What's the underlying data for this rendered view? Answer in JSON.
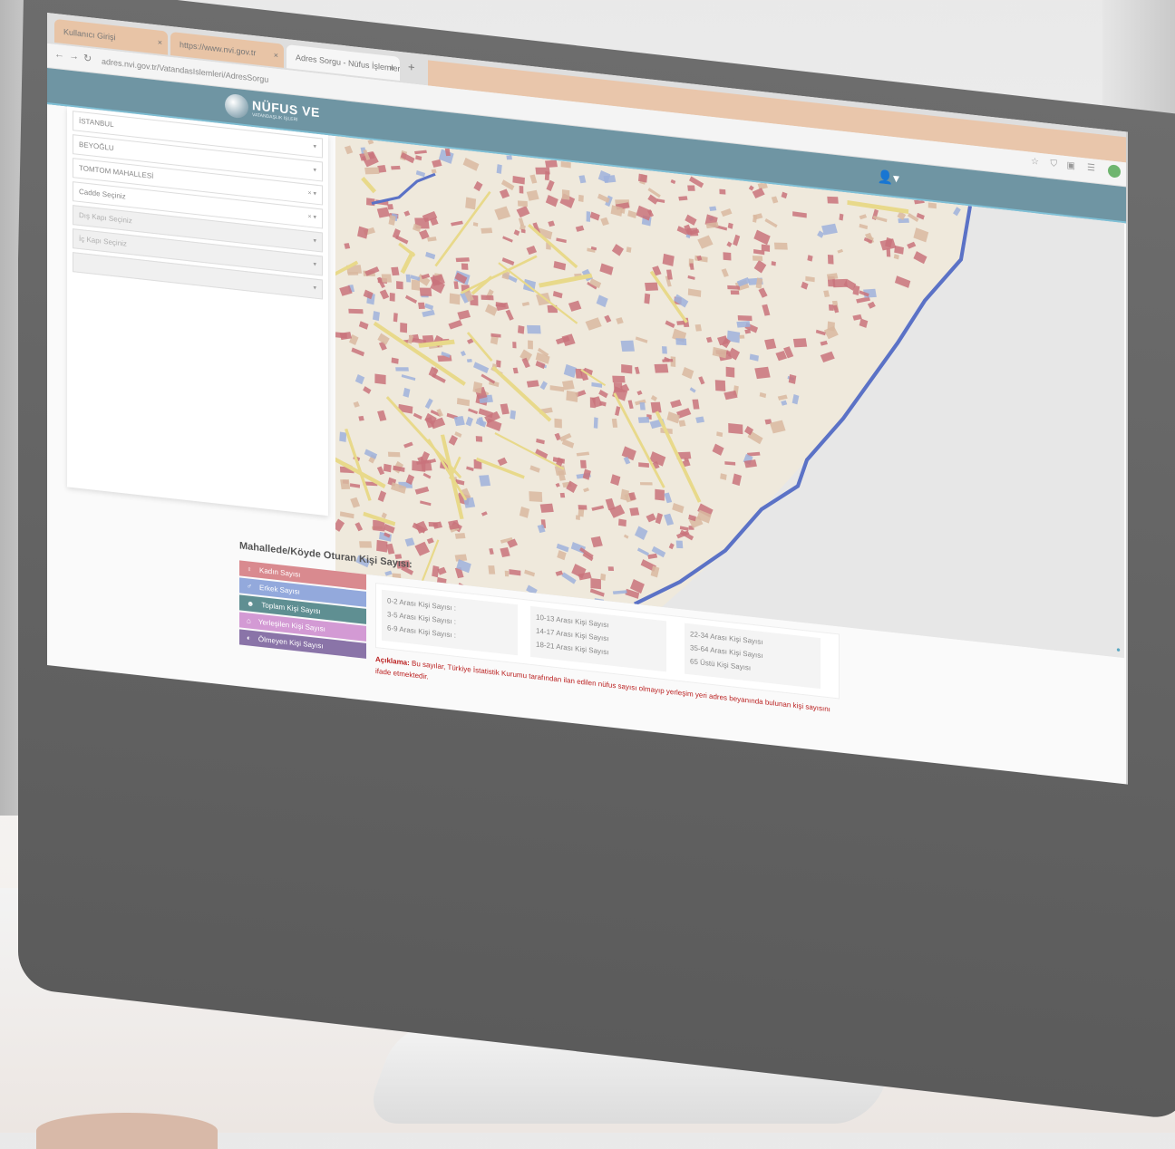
{
  "browser": {
    "tabs": [
      {
        "label": "Kullanıcı Girişi",
        "active": false
      },
      {
        "label": "https://www.nvi.gov.tr",
        "active": false
      },
      {
        "label": "Adres Sorgu - Nüfus İşlemleri",
        "active": true
      }
    ],
    "new_tab": "+",
    "close": "×",
    "url": "adres.nvi.gov.tr/VatandasIslemleri/AdresSorgu",
    "nav": {
      "back": "←",
      "forward": "→",
      "reload": "↻"
    }
  },
  "header": {
    "logo_title": "NÜFUS VE",
    "logo_subtitle": "VATANDAŞLIK İŞLERİ",
    "user_icon": "user-icon"
  },
  "filters": [
    {
      "value": "İSTANBUL",
      "disabled": false
    },
    {
      "value": "BEYOĞLU",
      "disabled": false
    },
    {
      "value": "TOMTOM MAHALLESİ",
      "disabled": false
    },
    {
      "value": "Cadde Seçiniz",
      "disabled": false
    },
    {
      "value": "Dış Kapı Seçiniz",
      "disabled": true
    },
    {
      "value": "İç Kapı Seçiniz",
      "disabled": true
    },
    {
      "value": "",
      "disabled": true
    }
  ],
  "stats": {
    "title": "Mahallede/Köyde Oturan Kişi Sayısı:",
    "categories": [
      {
        "label": "Kadın Sayısı",
        "color": "#d98a8f",
        "icon": "female-icon"
      },
      {
        "label": "Erkek Sayısı",
        "color": "#93a9dc",
        "icon": "male-icon"
      },
      {
        "label": "Toplam Kişi Sayısı",
        "color": "#5f8f92",
        "icon": "people-icon"
      },
      {
        "label": "Yerleşilen Kişi Sayısı",
        "color": "#d39ad4",
        "icon": "home-icon"
      },
      {
        "label": "Ölmeyen Kişi Sayısı",
        "color": "#8a74a8",
        "icon": "person-icon"
      }
    ],
    "age_groups": [
      [
        "0-2 Arası Kişi Sayısı :",
        "3-5 Arası Kişi Sayısı :",
        "6-9 Arası Kişi Sayısı :"
      ],
      [
        "10-13 Arası Kişi Sayısı",
        "14-17 Arası Kişi Sayısı",
        "18-21 Arası Kişi Sayısı"
      ],
      [
        "22-34 Arası Kişi Sayısı",
        "35-64 Arası Kişi Sayısı",
        "65 Üstü Kişi Sayısı"
      ]
    ],
    "note_label": "Açıklama:",
    "note_text": "Bu sayılar, Türkiye İstatistik Kurumu tarafından ilan edilen nüfus sayısı olmayıp yerleşim yeri adres beyanında bulunan kişi sayısını ifade etmektedir."
  },
  "colors": {
    "header": "#6f95a3",
    "accent": "#7fc0d6",
    "note": "#b22222"
  }
}
